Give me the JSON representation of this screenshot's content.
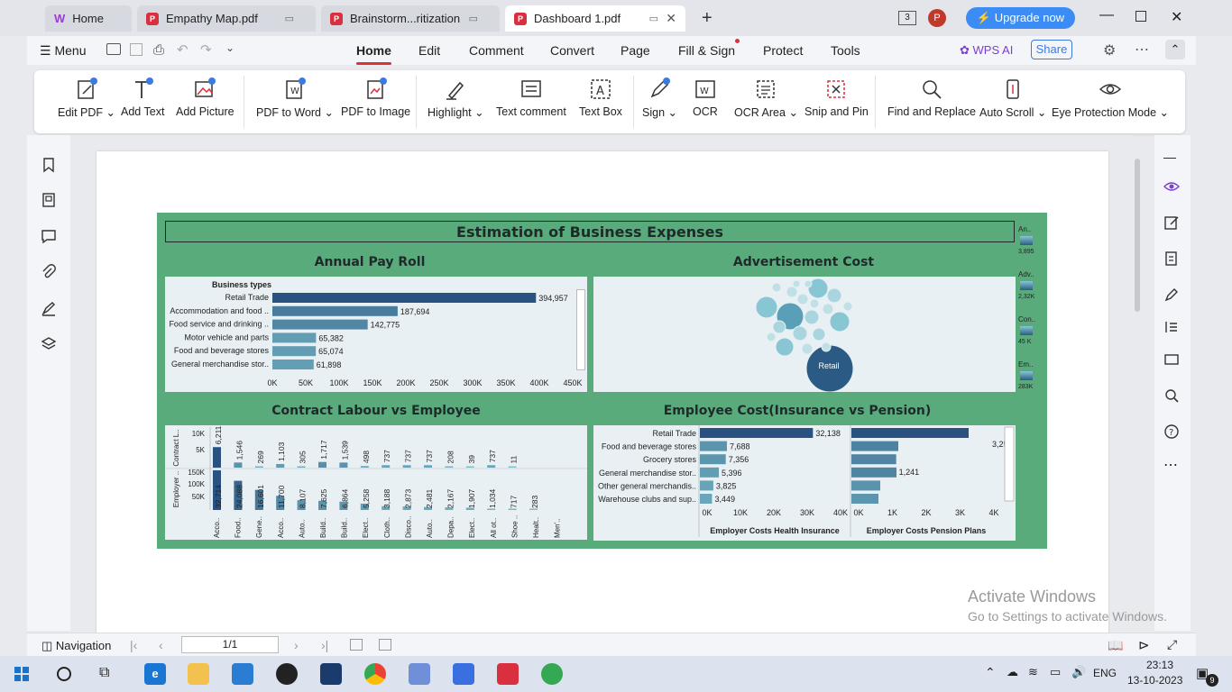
{
  "tabs": [
    {
      "label": "Home"
    },
    {
      "label": "Empathy Map.pdf"
    },
    {
      "label": "Brainstorm...ritization"
    },
    {
      "label": "Dashboard 1.pdf"
    }
  ],
  "titlebar": {
    "counter": "3",
    "avatar": "P",
    "upgrade_label": "Upgrade now"
  },
  "menu": {
    "menu_label": "Menu",
    "tabs": [
      "Home",
      "Edit",
      "Comment",
      "Convert",
      "Page",
      "Fill & Sign",
      "Protect",
      "Tools"
    ],
    "wps_ai": "WPS AI",
    "share": "Share"
  },
  "ribbon": {
    "buttons": [
      "Edit PDF",
      "Add Text",
      "Add Picture",
      "PDF to Word",
      "PDF to Image",
      "Highlight",
      "Text comment",
      "Text Box",
      "Sign",
      "OCR",
      "OCR Area",
      "Snip and Pin",
      "Find and Replace",
      "Auto Scroll",
      "Eye Protection Mode"
    ]
  },
  "dashboard": {
    "title": "Estimation of Business Expenses",
    "payroll_title": "Annual Pay Roll",
    "payroll_header": "Business types",
    "ad_title": "Advertisement Cost",
    "ad_bubble_label": "Retail",
    "contract_title": "Contract Labour vs Employee",
    "pension_title": "Employee Cost(Insurance vs Pension)",
    "insurance_axis_title": "Employer Costs Health Insurance",
    "pension_axis_title": "Employer Costs Pension Plans",
    "contract_row1_label": "Contract L..",
    "contract_row2_label": "Employer ..",
    "legend": [
      {
        "label": "An..",
        "range": "3,895"
      },
      {
        "label": "Adv..",
        "range": "2,32K"
      },
      {
        "label": "Con..",
        "range": "45 K"
      },
      {
        "label": "Em..",
        "range": "283K"
      }
    ]
  },
  "chart_data": [
    {
      "type": "bar",
      "title": "Annual Pay Roll",
      "categories": [
        "Retail Trade",
        "Accommodation and food ..",
        "Food service and drinking ..",
        "Motor vehicle and parts",
        "Food and beverage stores",
        "General merchandise stor.."
      ],
      "values": [
        394957,
        187694,
        142775,
        65382,
        65074,
        61898
      ],
      "value_labels": [
        "394,957",
        "187,694",
        "142,775",
        "65,382",
        "65,074",
        "61,898"
      ],
      "x_ticks": [
        "0K",
        "50K",
        "100K",
        "150K",
        "200K",
        "250K",
        "300K",
        "350K",
        "400K",
        "450K"
      ],
      "xlim": [
        0,
        450000
      ]
    },
    {
      "type": "bar",
      "title": "Contract Labour vs Employee",
      "categories": [
        "Acco..",
        "Food..",
        "Gene..",
        "Acco..",
        "Auto..",
        "Build..",
        "Build..",
        "Elect..",
        "Cloth..",
        "Disco..",
        "Auto..",
        "Depa..",
        "Elect..",
        "All ot..",
        "Shoe ..",
        "Healt..",
        "Men'.."
      ],
      "series": [
        {
          "name": "Contract L..",
          "values": [
            6211,
            1546,
            269,
            1103,
            305,
            1717,
            1539,
            498,
            737,
            737,
            737,
            208,
            39,
            737,
            11
          ],
          "value_labels": [
            "6,211",
            "1,546",
            "269",
            "1,103",
            "305",
            "1,717",
            "1,539",
            "498",
            "737",
            "737",
            "737",
            "208",
            "39",
            "737",
            "11"
          ],
          "y_ticks": [
            "10K",
            "5K"
          ],
          "ylim": [
            0,
            12000
          ]
        },
        {
          "name": "Employer ..",
          "values": [
            32714,
            24088,
            16601,
            11700,
            8107,
            7625,
            6864,
            5258,
            3188,
            2873,
            2481,
            2167,
            1907,
            1034,
            717,
            283
          ],
          "value_labels": [
            "32,714",
            "24,088",
            "16,601",
            "11,700",
            "8,107",
            "7,625",
            "6,864",
            "5,258",
            "3,188",
            "2,873",
            "2,481",
            "2,167",
            "1,907",
            "1,034",
            "717",
            "283"
          ],
          "y_ticks": [
            "150K",
            "100K",
            "50K"
          ],
          "ylim": [
            0,
            160000
          ]
        }
      ]
    },
    {
      "type": "bar",
      "title": "Employee Cost(Insurance vs Pension)",
      "categories": [
        "Retail Trade",
        "Food and beverage stores",
        "Grocery stores",
        "General merchandise stor..",
        "Other general merchandis..",
        "Warehouse clubs and sup.."
      ],
      "series": [
        {
          "name": "Employer Costs Health Insurance",
          "values": [
            32138,
            7688,
            7356,
            5396,
            3825,
            3449
          ],
          "value_labels": [
            "32,138",
            "7,688",
            "7,356",
            "5,396",
            "3,825",
            "3,449"
          ],
          "x_ticks": [
            "0K",
            "10K",
            "20K",
            "30K",
            "40K"
          ],
          "xlim": [
            0,
            40000
          ]
        },
        {
          "name": "Employer Costs Pension Plans",
          "values": [
            3250,
            1300,
            1241,
            1250,
            800,
            750
          ],
          "value_labels": [
            "3,250",
            "",
            "1,241",
            "",
            "",
            ""
          ],
          "x_ticks": [
            "0K",
            "1K",
            "2K",
            "3K",
            "4K"
          ],
          "xlim": [
            0,
            4000
          ]
        }
      ]
    }
  ],
  "statusbar": {
    "navigation": "Navigation",
    "page": "1/1"
  },
  "watermark": {
    "line1": "Activate Windows",
    "line2": "Go to Settings to activate Windows."
  },
  "taskbar": {
    "time": "23:13",
    "date": "13-10-2023",
    "lang": "ENG",
    "notif": "9"
  }
}
